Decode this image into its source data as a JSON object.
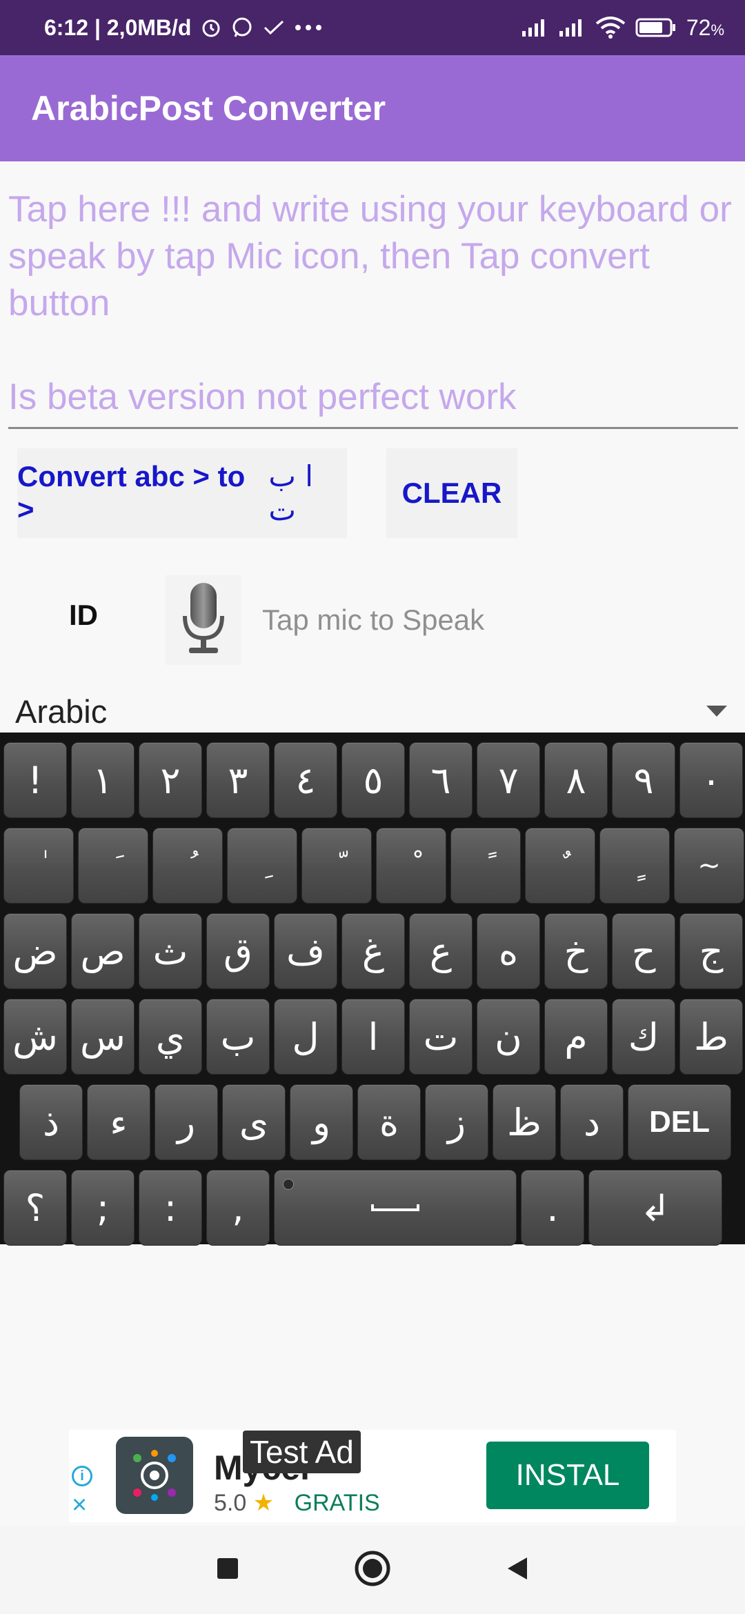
{
  "status_bar": {
    "time_and_data": "6:12 | 2,0MB/d",
    "battery": "72",
    "battery_unit": "%"
  },
  "app_bar": {
    "title": "ArabicPost Converter"
  },
  "input": {
    "placeholder": "Tap here !!! and write using your keyboard or speak by tap Mic icon, then Tap convert button\n\nIs beta version not perfect work"
  },
  "buttons": {
    "convert_label": "Convert abc > to >",
    "convert_arabic": "ا ب ت",
    "clear_label": "CLEAR"
  },
  "speech": {
    "id_label": "ID",
    "mic_hint": "Tap mic to Speak"
  },
  "language_select": {
    "selected": "Arabic"
  },
  "keyboard": {
    "rows": [
      [
        "!",
        "١",
        "٢",
        "٣",
        "٤",
        "٥",
        "٦",
        "٧",
        "٨",
        "٩",
        "٠"
      ],
      [
        "ٰ",
        "َ",
        "ُ",
        "ِ",
        "ّ",
        "ْ",
        "ً",
        "ٌ",
        "ٍ",
        "~"
      ],
      [
        "ض",
        "ص",
        "ث",
        "ق",
        "ف",
        "غ",
        "ع",
        "ه",
        "خ",
        "ح",
        "ج"
      ],
      [
        "ش",
        "س",
        "ي",
        "ب",
        "ل",
        "ا",
        "ت",
        "ن",
        "م",
        "ك",
        "ط"
      ],
      [
        "ذ",
        "ء",
        "ر",
        "ى",
        "و",
        "ة",
        "ز",
        "ظ",
        "د",
        "DEL"
      ],
      [
        "؟",
        ";",
        ":",
        ",",
        "␣",
        ".",
        "↲"
      ]
    ]
  },
  "ad": {
    "title": "Mycel",
    "rating": "5.0",
    "price": "GRATIS",
    "label": "Test Ad",
    "install": "INSTAL"
  },
  "colors": {
    "status_bar": "#482469",
    "app_bar": "#9a6ad4",
    "hint_text": "#c5a8ec",
    "button_text": "#1717c9",
    "install_button": "#01875f"
  }
}
